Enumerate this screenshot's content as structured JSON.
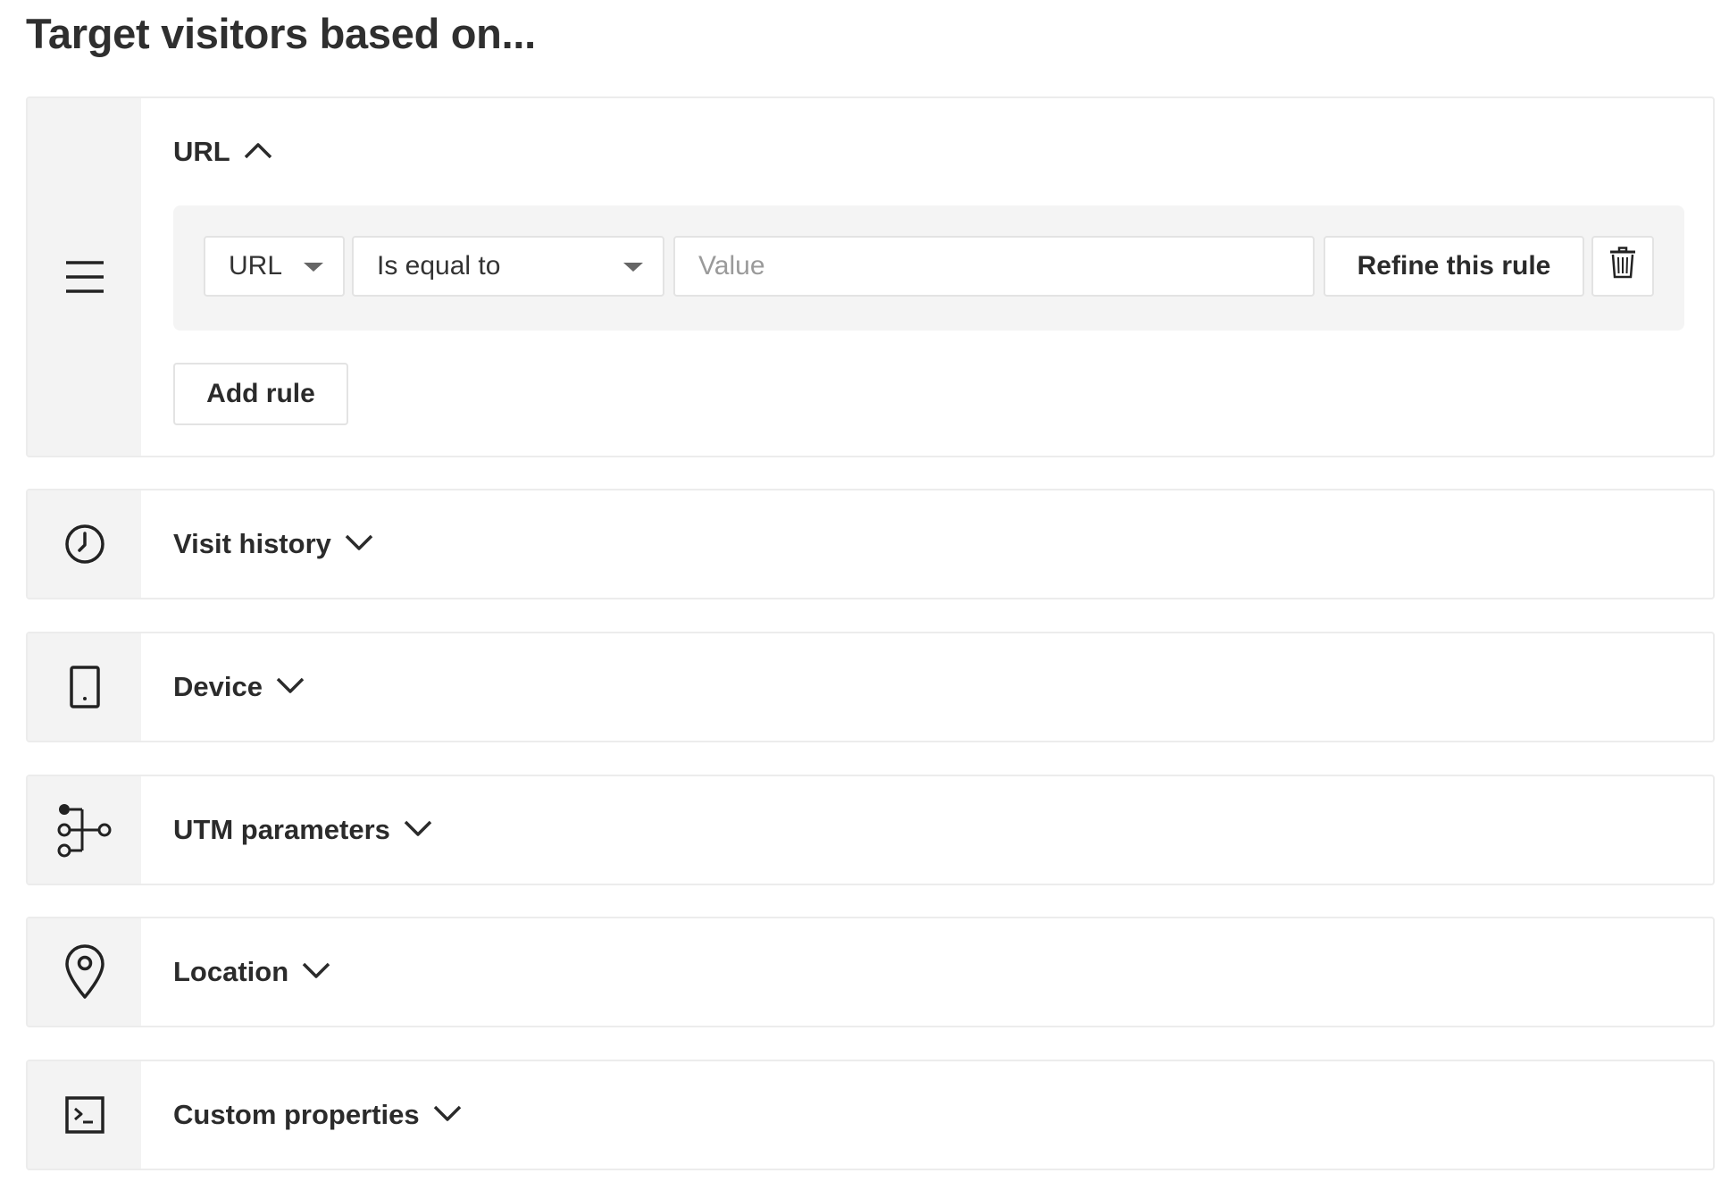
{
  "page": {
    "title": "Target visitors based on..."
  },
  "sections": {
    "url": {
      "title": "URL",
      "icon": "menu-lines-icon",
      "expanded": true,
      "rule": {
        "field_select": "URL",
        "operator_select": "Is equal to",
        "value_placeholder": "Value",
        "value": "",
        "refine_label": "Refine this rule"
      },
      "add_rule_label": "Add rule"
    },
    "visit_history": {
      "title": "Visit history",
      "icon": "clock-icon",
      "expanded": false
    },
    "device": {
      "title": "Device",
      "icon": "mobile-device-icon",
      "expanded": false
    },
    "utm": {
      "title": "UTM parameters",
      "icon": "utm-branch-icon",
      "expanded": false
    },
    "location": {
      "title": "Location",
      "icon": "map-pin-icon",
      "expanded": false
    },
    "custom": {
      "title": "Custom properties",
      "icon": "terminal-icon",
      "expanded": false
    }
  },
  "colors": {
    "text": "#2b2b2b",
    "border": "#ececec",
    "icon_column_bg": "#f3f3f3",
    "rule_row_bg": "#f4f4f4",
    "placeholder": "#9a9a9a"
  }
}
